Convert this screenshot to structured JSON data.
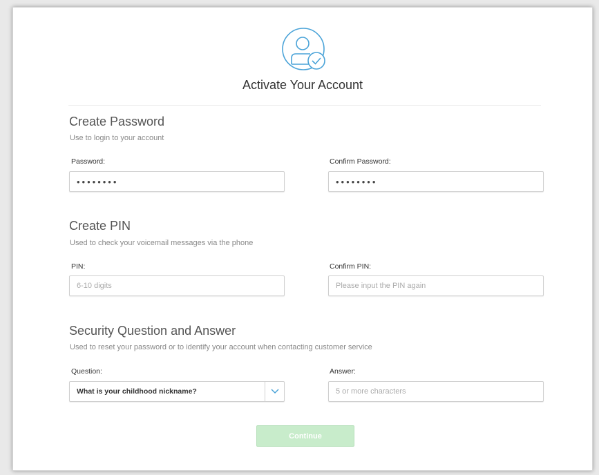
{
  "header": {
    "title": "Activate Your Account",
    "icon": "user-check-icon",
    "accent_color": "#4aa3d8"
  },
  "password_section": {
    "title": "Create Password",
    "subtitle": "Use to login to your account",
    "password_label": "Password:",
    "password_value": "••••••••",
    "confirm_label": "Confirm Password:",
    "confirm_value": "••••••••"
  },
  "pin_section": {
    "title": "Create PIN",
    "subtitle": "Used to check your voicemail messages via the phone",
    "pin_label": "PIN:",
    "pin_placeholder": "6-10 digits",
    "confirm_label": "Confirm PIN:",
    "confirm_placeholder": "Please input the PIN again"
  },
  "security_section": {
    "title": "Security Question and Answer",
    "subtitle": "Used to reset your password or to identify your account when contacting customer service",
    "question_label": "Question:",
    "question_selected": "What is your childhood nickname?",
    "answer_label": "Answer:",
    "answer_placeholder": "5 or more characters"
  },
  "actions": {
    "continue_label": "Continue",
    "continue_color": "#c8eccb"
  }
}
